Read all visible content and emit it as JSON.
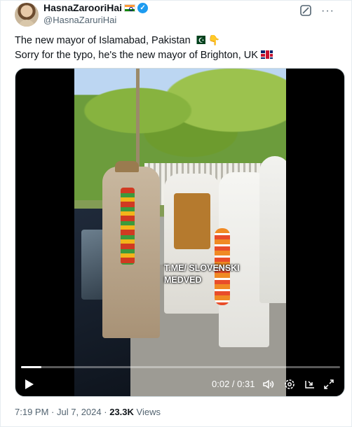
{
  "author": {
    "display_name": "HasnaZarooriHai",
    "handle": "@HasnaZaruriHai",
    "verified_badge": "✓",
    "flag_icon": "india-flag-icon"
  },
  "tweet": {
    "line1": "The new mayor of Islamabad, Pakistan",
    "line2": "Sorry for the typo, he's the new mayor of Brighton, UK",
    "line1_emojis": [
      "pakistan-flag-emoji",
      "pointing-down-emoji"
    ],
    "line2_emojis": [
      "uk-flag-emoji"
    ]
  },
  "video": {
    "watermark_line1": "T.ME/ SLOVENSKI",
    "watermark_line2": "MEDVED",
    "time_display": "0:02 / 0:31",
    "progress_fraction": 0.0645
  },
  "meta": {
    "time": "7:19 PM",
    "separator": "·",
    "date": "Jul 7, 2024",
    "views_count": "23.3K",
    "views_label": "Views"
  },
  "colors": {
    "accent": "#1d9bf0",
    "text": "#0f1419",
    "secondary": "#536471"
  }
}
